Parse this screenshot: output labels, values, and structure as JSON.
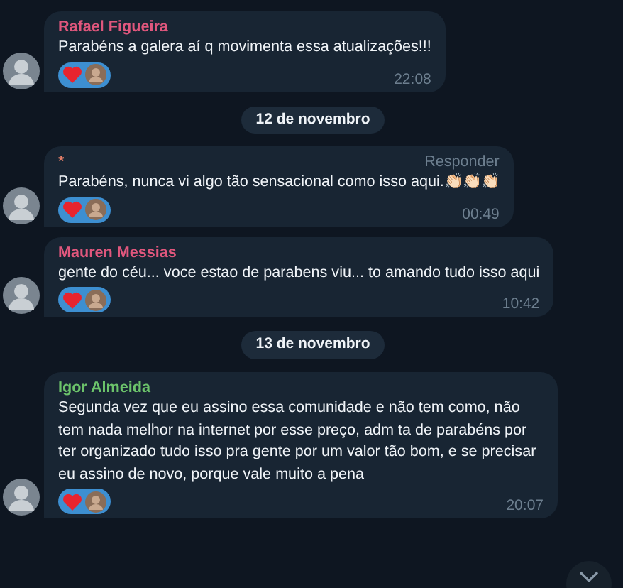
{
  "chat": [
    {
      "kind": "message",
      "author": "Rafael Figueira",
      "color": "#e0577d",
      "text": "Parabéns a galera aí q movimenta essa atualizações!!!",
      "time": "22:08"
    },
    {
      "kind": "date",
      "text": "12 de novembro"
    },
    {
      "kind": "message",
      "author": "*",
      "color": "#e8806a",
      "reply_hint": "Responder",
      "text": "Parabéns, nunca vi algo tão sensacional como isso aqui.👏🏻👏🏻👏🏻",
      "time": "00:49"
    },
    {
      "kind": "message",
      "author": "Mauren Messias",
      "color": "#e0577d",
      "text": "gente do céu... voce estao de parabens viu... to amando tudo isso aqui",
      "time": "10:42"
    },
    {
      "kind": "date",
      "text": "13 de novembro"
    },
    {
      "kind": "message",
      "author": "Igor Almeida",
      "color": "#6cc36b",
      "text": "Segunda vez que eu assino essa comunidade e não tem como, não tem nada melhor na internet por esse preço, adm ta de parabéns por ter organizado tudo isso pra gente por um valor tão bom, e se precisar eu assino de novo, porque vale muito a pena",
      "time": "20:07"
    }
  ]
}
